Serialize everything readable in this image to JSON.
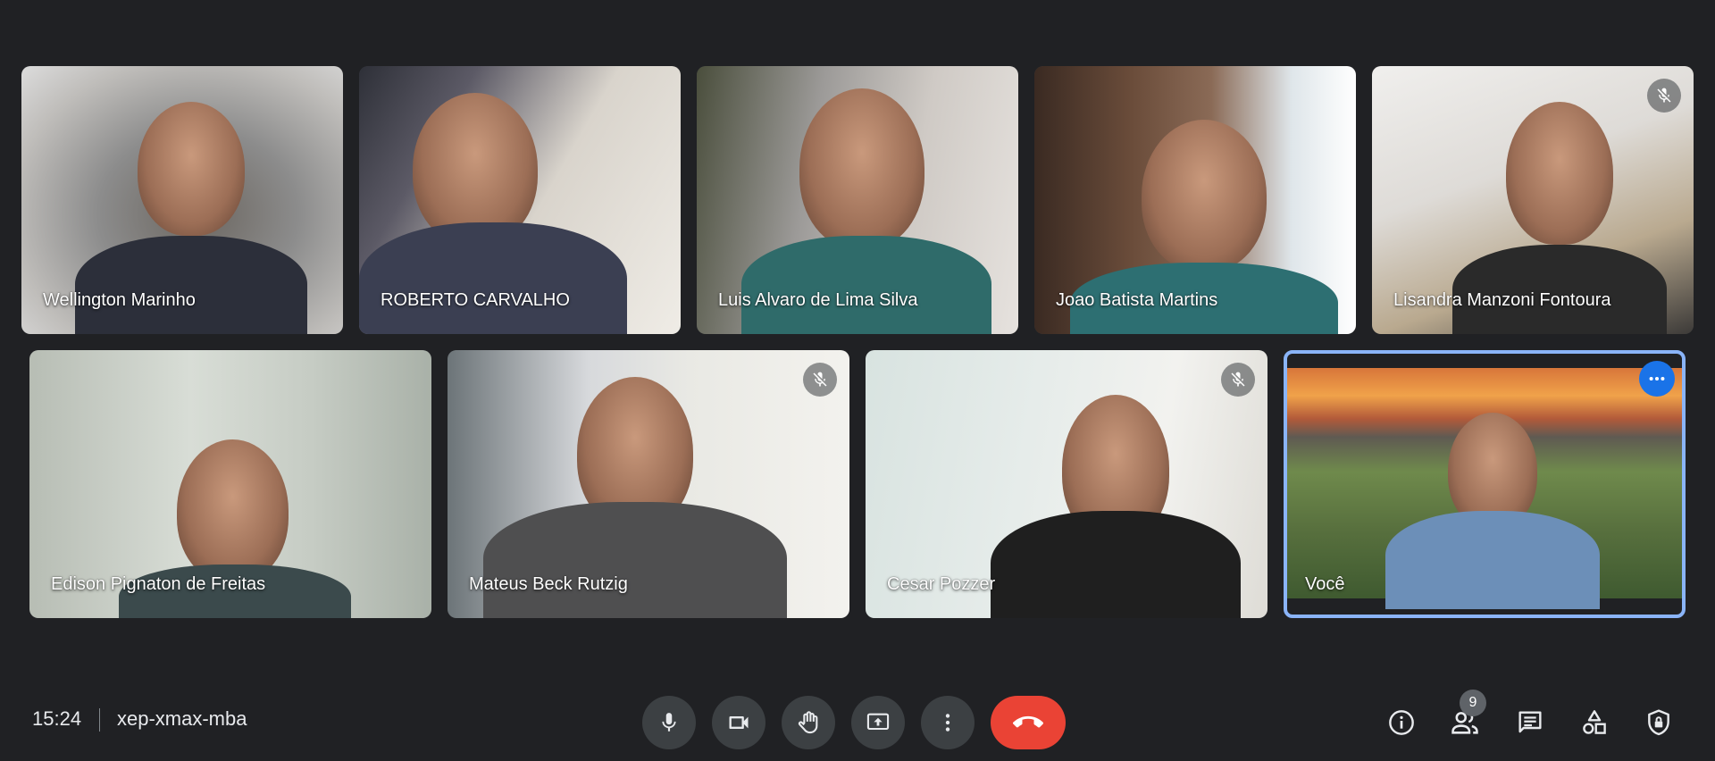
{
  "participants": [
    {
      "name": "Wellington Marinho",
      "muted": false
    },
    {
      "name": "ROBERTO CARVALHO",
      "muted": false
    },
    {
      "name": "Luis Alvaro de Lima Silva",
      "muted": false
    },
    {
      "name": "Joao Batista Martins",
      "muted": false
    },
    {
      "name": "Lisandra Manzoni Fontoura",
      "muted": true
    },
    {
      "name": "Edison Pignaton de Freitas",
      "muted": false
    },
    {
      "name": "Mateus Beck Rutzig",
      "muted": true
    },
    {
      "name": "Cesar Pozzer",
      "muted": true
    },
    {
      "name": "Você",
      "muted": false,
      "self": true
    }
  ],
  "bottom_bar": {
    "time": "15:24",
    "meeting_code": "xep-xmax-mba",
    "people_count": "9"
  },
  "icons": {
    "mic": "microphone-icon",
    "camera": "camera-icon",
    "hand": "raise-hand-icon",
    "present": "present-screen-icon",
    "more": "more-options-icon",
    "leave": "leave-call-icon",
    "info": "info-icon",
    "people": "people-icon",
    "chat": "chat-icon",
    "activities": "activities-icon",
    "host": "host-controls-icon"
  },
  "colors": {
    "background": "#202124",
    "control": "#3c4043",
    "end_call": "#ea4335",
    "self_border": "#8ab4f8",
    "accent": "#1a73e8"
  }
}
